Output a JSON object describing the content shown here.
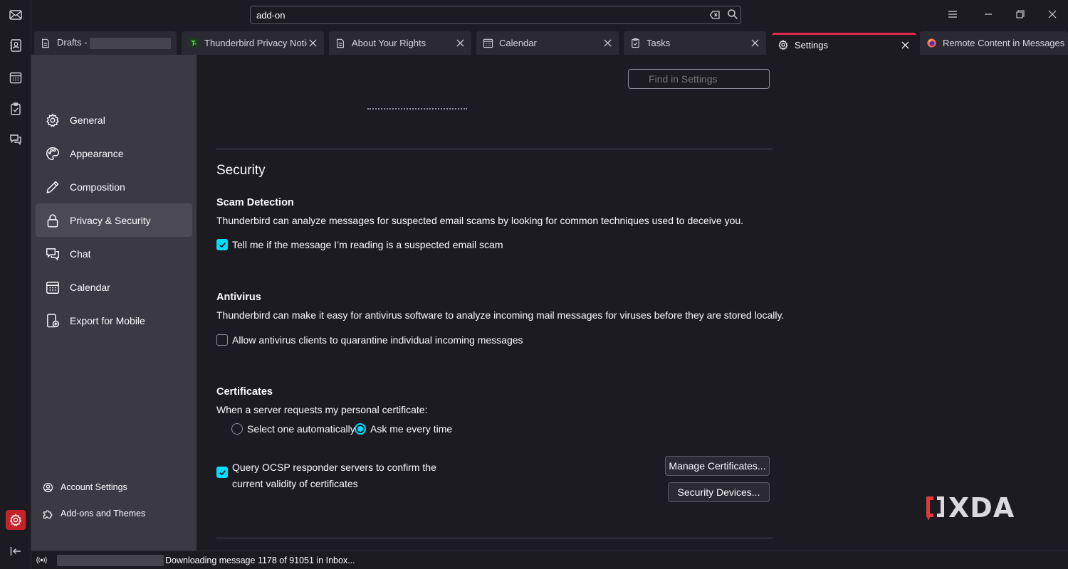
{
  "spaces": {
    "items": [
      "mail-icon",
      "address-book-icon",
      "calendar-icon",
      "tasks-icon",
      "chat-icon",
      "settings-icon",
      "collapse-icon"
    ],
    "active_color": "#c2242a"
  },
  "titlebar": {
    "search_value": "add-on",
    "menu_icon": "hamburger-icon",
    "minimize_icon": "minimize-icon",
    "restore_icon": "restore-icon",
    "close_icon": "close-icon"
  },
  "tabs": [
    {
      "label": "Drafts - ",
      "icon": "drafts-icon"
    },
    {
      "label": "Thunderbird Privacy Notice",
      "icon": "tb-favicon"
    },
    {
      "label": "About Your Rights",
      "icon": "document-icon"
    },
    {
      "label": "Calendar",
      "icon": "calendar-icon"
    },
    {
      "label": "Tasks",
      "icon": "tasks-icon"
    },
    {
      "label": "Settings",
      "icon": "gear-icon",
      "selected": true
    },
    {
      "label": "Remote Content in Messages",
      "icon": "firefox-icon"
    }
  ],
  "sidebar": {
    "categories": [
      {
        "label": "General",
        "icon": "gear-icon"
      },
      {
        "label": "Appearance",
        "icon": "palette-icon"
      },
      {
        "label": "Composition",
        "icon": "pencil-icon"
      },
      {
        "label": "Privacy & Security",
        "icon": "lock-icon",
        "active": true
      },
      {
        "label": "Chat",
        "icon": "chat-icon"
      },
      {
        "label": "Calendar",
        "icon": "calendar-icon"
      },
      {
        "label": "Export for Mobile",
        "icon": "mobile-export-icon"
      }
    ],
    "footer": [
      {
        "label": "Account Settings",
        "icon": "account-icon"
      },
      {
        "label": "Add-ons and Themes",
        "icon": "puzzle-icon"
      }
    ]
  },
  "main": {
    "find_placeholder": "Find in Settings",
    "section_title": "Security",
    "scam": {
      "heading": "Scam Detection",
      "description": "Thunderbird can analyze messages for suspected email scams by looking for common techniques used to deceive you.",
      "checkbox_label": "Tell me if the message I’m reading is a suspected email scam",
      "checked": true
    },
    "antivirus": {
      "heading": "Antivirus",
      "description": "Thunderbird can make it easy for antivirus software to analyze incoming mail messages for viruses before they are stored locally.",
      "checkbox_label": "Allow antivirus clients to quarantine individual incoming messages",
      "checked": false
    },
    "certificates": {
      "heading": "Certificates",
      "prompt": "When a server requests my personal certificate:",
      "radio_auto": "Select one automatically",
      "radio_ask": "Ask me every time",
      "selected": "Ask me every time",
      "ocsp_line1": "Query OCSP responder servers to confirm the",
      "ocsp_line2": "current validity of certificates",
      "ocsp_checked": true,
      "manage_button": "Manage Certificates...",
      "devices_button": "Security Devices..."
    },
    "accent_color": "#00ddff"
  },
  "status": {
    "text": "Downloading message 1178 of 91051 in Inbox..."
  },
  "watermark": {
    "text": "XDA"
  }
}
